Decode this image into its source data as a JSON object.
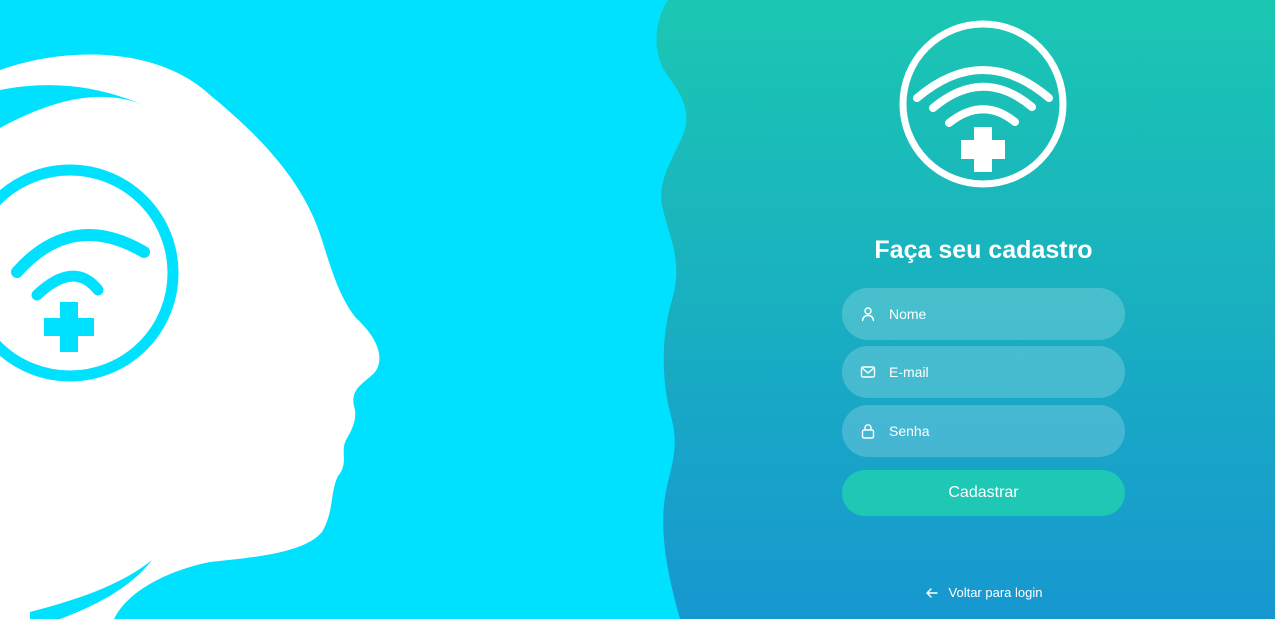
{
  "colors": {
    "left_background": "#00e1ff",
    "panel_gradient_top": "#1bc7b2",
    "panel_gradient_bottom": "#1797d0",
    "button_background": "#1ec8b4",
    "foreground": "#ffffff"
  },
  "illustration": {
    "icon": "head-with-wifi-cross-icon"
  },
  "logo": {
    "icon": "wifi-cross-circle-icon"
  },
  "form": {
    "title": "Faça seu cadastro",
    "fields": [
      {
        "icon": "user-icon",
        "placeholder": "Nome",
        "value": ""
      },
      {
        "icon": "mail-icon",
        "placeholder": "E-mail",
        "value": ""
      },
      {
        "icon": "lock-icon",
        "placeholder": "Senha",
        "value": ""
      }
    ],
    "submit_label": "Cadastrar",
    "back_link_label": "Voltar para login",
    "back_link_icon": "arrow-left-icon"
  }
}
